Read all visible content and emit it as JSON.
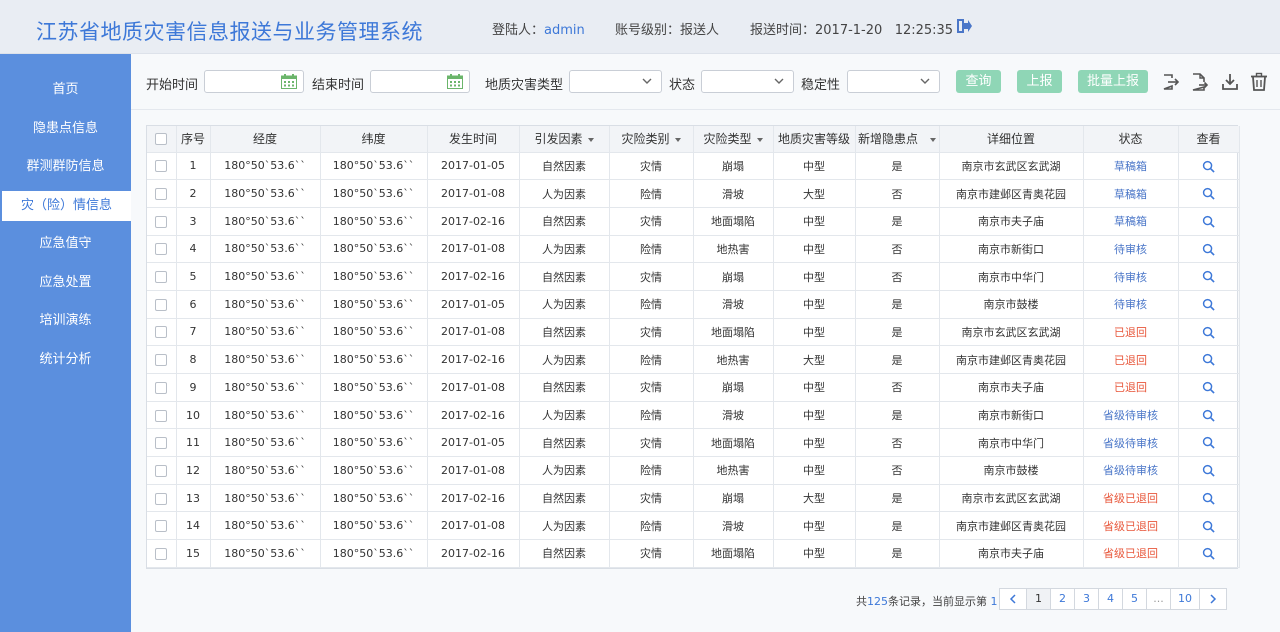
{
  "header": {
    "title": "江苏省地质灾害信息报送与业务管理系统",
    "user_label": "登陆人：",
    "user_value": "admin",
    "level_label": "账号级别：",
    "level_value": "报送人",
    "time_label": "报送时间：",
    "time_value": "2017-1-20   12:25:35"
  },
  "sidebar": {
    "items": [
      {
        "label": "首页"
      },
      {
        "label": "隐患点信息"
      },
      {
        "label": "群测群防信息"
      },
      {
        "label": "灾（险）情信息"
      },
      {
        "label": "应急值守"
      },
      {
        "label": "应急处置"
      },
      {
        "label": "培训演练"
      },
      {
        "label": "统计分析"
      }
    ],
    "active_index": 3
  },
  "filters": {
    "start_label": "开始时间",
    "end_label": "结束时间",
    "type_label": "地质灾害类型",
    "status_label": "状态",
    "stability_label": "稳定性",
    "start_value": "",
    "end_value": "",
    "type_value": "",
    "status_value": "",
    "stability_value": ""
  },
  "buttons": {
    "query": "查询",
    "report": "上报",
    "batch_report": "批量上报"
  },
  "table": {
    "headers": [
      "序号",
      "经度",
      "纬度",
      "发生时间",
      "引发因素",
      "灾险类别",
      "灾险类型",
      "地质灾害等级",
      "新增隐患点",
      "详细位置",
      "状态",
      "查看"
    ],
    "rows": [
      [
        "1",
        "180°50`53.6``",
        "180°50`53.6``",
        "2017-01-05",
        "自然因素",
        "灾情",
        "崩塌",
        "中型",
        "是",
        "南京市玄武区玄武湖",
        "草稿箱"
      ],
      [
        "2",
        "180°50`53.6``",
        "180°50`53.6``",
        "2017-01-08",
        "人为因素",
        "险情",
        "滑坡",
        "大型",
        "否",
        "南京市建邺区青奥花园",
        "草稿箱"
      ],
      [
        "3",
        "180°50`53.6``",
        "180°50`53.6``",
        "2017-02-16",
        "自然因素",
        "灾情",
        "地面塌陷",
        "中型",
        "是",
        "南京市夫子庙",
        "草稿箱"
      ],
      [
        "4",
        "180°50`53.6``",
        "180°50`53.6``",
        "2017-01-08",
        "人为因素",
        "险情",
        "地热害",
        "中型",
        "否",
        "南京市新街口",
        "待审核"
      ],
      [
        "5",
        "180°50`53.6``",
        "180°50`53.6``",
        "2017-02-16",
        "自然因素",
        "灾情",
        "崩塌",
        "中型",
        "否",
        "南京市中华门",
        "待审核"
      ],
      [
        "6",
        "180°50`53.6``",
        "180°50`53.6``",
        "2017-01-05",
        "人为因素",
        "险情",
        "滑坡",
        "中型",
        "是",
        "南京市鼓楼",
        "待审核"
      ],
      [
        "7",
        "180°50`53.6``",
        "180°50`53.6``",
        "2017-01-08",
        "自然因素",
        "灾情",
        "地面塌陷",
        "中型",
        "是",
        "南京市玄武区玄武湖",
        "已退回"
      ],
      [
        "8",
        "180°50`53.6``",
        "180°50`53.6``",
        "2017-02-16",
        "人为因素",
        "险情",
        "地热害",
        "大型",
        "是",
        "南京市建邺区青奥花园",
        "已退回"
      ],
      [
        "9",
        "180°50`53.6``",
        "180°50`53.6``",
        "2017-01-08",
        "自然因素",
        "灾情",
        "崩塌",
        "中型",
        "否",
        "南京市夫子庙",
        "已退回"
      ],
      [
        "10",
        "180°50`53.6``",
        "180°50`53.6``",
        "2017-02-16",
        "人为因素",
        "险情",
        "滑坡",
        "中型",
        "是",
        "南京市新街口",
        "省级待审核"
      ],
      [
        "11",
        "180°50`53.6``",
        "180°50`53.6``",
        "2017-01-05",
        "自然因素",
        "灾情",
        "地面塌陷",
        "中型",
        "否",
        "南京市中华门",
        "省级待审核"
      ],
      [
        "12",
        "180°50`53.6``",
        "180°50`53.6``",
        "2017-01-08",
        "人为因素",
        "险情",
        "地热害",
        "中型",
        "否",
        "南京市鼓楼",
        "省级待审核"
      ],
      [
        "13",
        "180°50`53.6``",
        "180°50`53.6``",
        "2017-02-16",
        "自然因素",
        "灾情",
        "崩塌",
        "大型",
        "是",
        "南京市玄武区玄武湖",
        "省级已退回"
      ],
      [
        "14",
        "180°50`53.6``",
        "180°50`53.6``",
        "2017-01-08",
        "人为因素",
        "险情",
        "滑坡",
        "中型",
        "是",
        "南京市建邺区青奥花园",
        "省级已退回"
      ],
      [
        "15",
        "180°50`53.6``",
        "180°50`53.6``",
        "2017-02-16",
        "自然因素",
        "灾情",
        "地面塌陷",
        "中型",
        "是",
        "南京市夫子庙",
        "省级已退回"
      ]
    ],
    "status_colors": {
      "草稿箱": "#4a76c8",
      "待审核": "#4a76c8",
      "已退回": "#e8573b",
      "省级待审核": "#4a76c8",
      "省级已退回": "#e8573b"
    }
  },
  "pagination": {
    "summary_prefix": "共",
    "total": "125",
    "summary_mid": "条记录，当前显示第",
    "current": "1",
    "summary_suffix": "页",
    "pages": [
      "1",
      "2",
      "3",
      "4",
      "5",
      "...",
      "10"
    ]
  },
  "icons": {
    "logout": "logout-icon",
    "calendar": "calendar-icon",
    "export": "export-icon",
    "export_file": "export-file-icon",
    "download": "download-icon",
    "delete": "trash-icon",
    "view": "search-icon"
  },
  "colors": {
    "brand": "#3d78d8",
    "sidebar": "#5b8fde",
    "button": "#8fd6b6",
    "calendar": "#6bb56b"
  }
}
